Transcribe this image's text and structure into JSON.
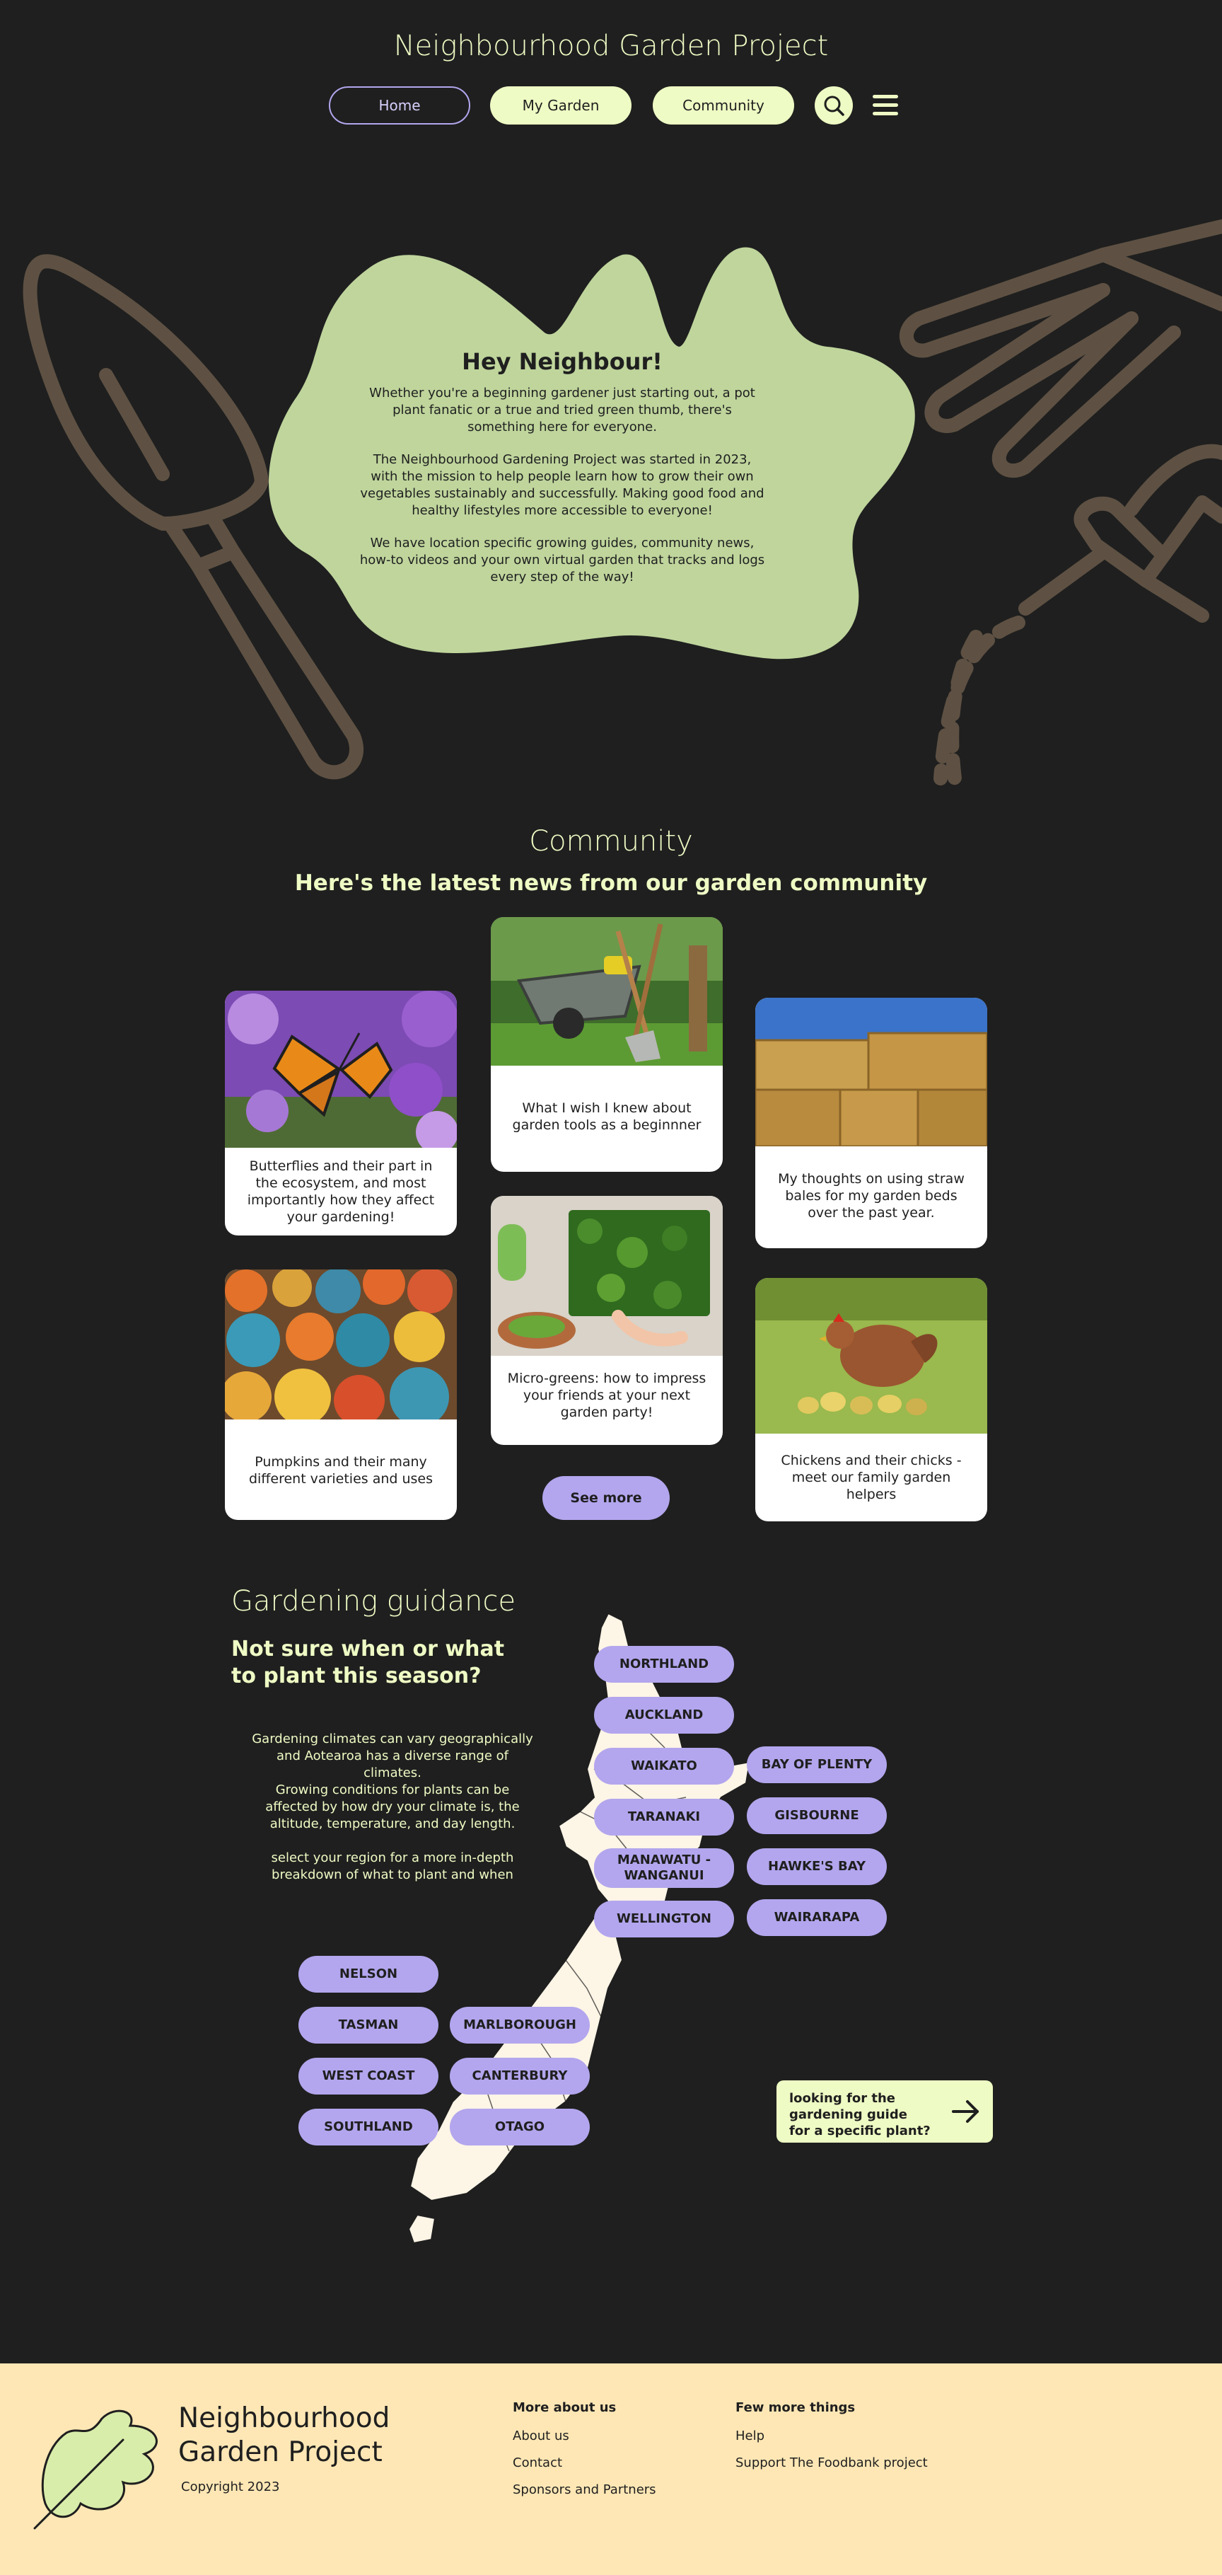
{
  "header": {
    "title": "Neighbourhood Garden Project",
    "nav": [
      {
        "label": "Home"
      },
      {
        "label": "My Garden"
      },
      {
        "label": "Community"
      }
    ]
  },
  "hero": {
    "heading": "Hey Neighbour!",
    "paragraphs": [
      "Whether you're a beginning gardener just starting out, a pot plant fanatic or a true and tried green thumb, there's something here for everyone.",
      "The Neighbourhood Gardening Project was started in 2023, with the mission to help people learn how to grow their own vegetables sustainably and successfully. Making good food and healthy lifestyles more accessible to everyone!",
      "We have location specific growing guides, community news, how-to videos and your own virtual garden that tracks and logs every step of the way!"
    ]
  },
  "community": {
    "title": "Community",
    "subtitle": "Here's the latest news from our garden community",
    "cards": [
      {
        "text": "Butterflies and their part in the ecosystem, and most importantly how they affect your gardening!",
        "image": "butterfly-photo"
      },
      {
        "text": "What I wish I knew about garden tools as a beginnner",
        "image": "wheelbarrow-photo"
      },
      {
        "text": "My thoughts on using straw bales for my garden beds over the past year.",
        "image": "straw-bales-photo"
      },
      {
        "text": "Pumpkins and their many different varieties and uses",
        "image": "pumpkins-photo"
      },
      {
        "text": "Micro-greens: how to impress your friends at your next garden party!",
        "image": "microgreens-photo"
      },
      {
        "text": "Chickens and their chicks - meet our family garden helpers",
        "image": "chickens-photo"
      }
    ],
    "see_more": "See more"
  },
  "guidance": {
    "title": "Gardening guidance",
    "subtitle": "Not sure when or what to plant this season?",
    "body_1": "Gardening climates can vary geographically and Aotearoa has a diverse range of climates.",
    "body_2": "Growing conditions for plants can be affected by how dry your climate is, the altitude, temperature, and day length.",
    "body_3": "select your region for a more in-depth breakdown of what to plant and when",
    "regions": {
      "northland": "NORTHLAND",
      "auckland": "AUCKLAND",
      "waikato": "WAIKATO",
      "bay_of_plenty": "BAY OF PLENTY",
      "taranaki": "TARANAKI",
      "gisbourne": "GISBOURNE",
      "manawatu": "MANAWATU - WANGANUI",
      "hawkes_bay": "HAWKE'S BAY",
      "wellington": "WELLINGTON",
      "wairarapa": "WAIRARAPA",
      "nelson": "NELSON",
      "tasman": "TASMAN",
      "marlborough": "MARLBOROUGH",
      "west_coast": "WEST COAST",
      "canterbury": "CANTERBURY",
      "southland": "SOUTHLAND",
      "otago": "OTAGO"
    },
    "plant_cta": "looking for the gardening guide for a specific plant?"
  },
  "footer": {
    "brand_line1": "Neighbourhood",
    "brand_line2": "Garden Project",
    "copyright": "Copyright 2023",
    "col1": {
      "heading": "More about us",
      "links": [
        "About us",
        "Contact",
        "Sponsors and Partners"
      ]
    },
    "col2": {
      "heading": "Few more things",
      "links": [
        "Help",
        "Support The Foodbank project"
      ]
    }
  },
  "colors": {
    "background": "#1f1f1f",
    "accent_lime": "#eefbc4",
    "accent_lavender": "#b3a6ee",
    "hero_green": "#bfd59c",
    "tool_brown": "#5e5143",
    "footer_cream": "#fee7b5",
    "map_cream": "#fdf5e6"
  }
}
